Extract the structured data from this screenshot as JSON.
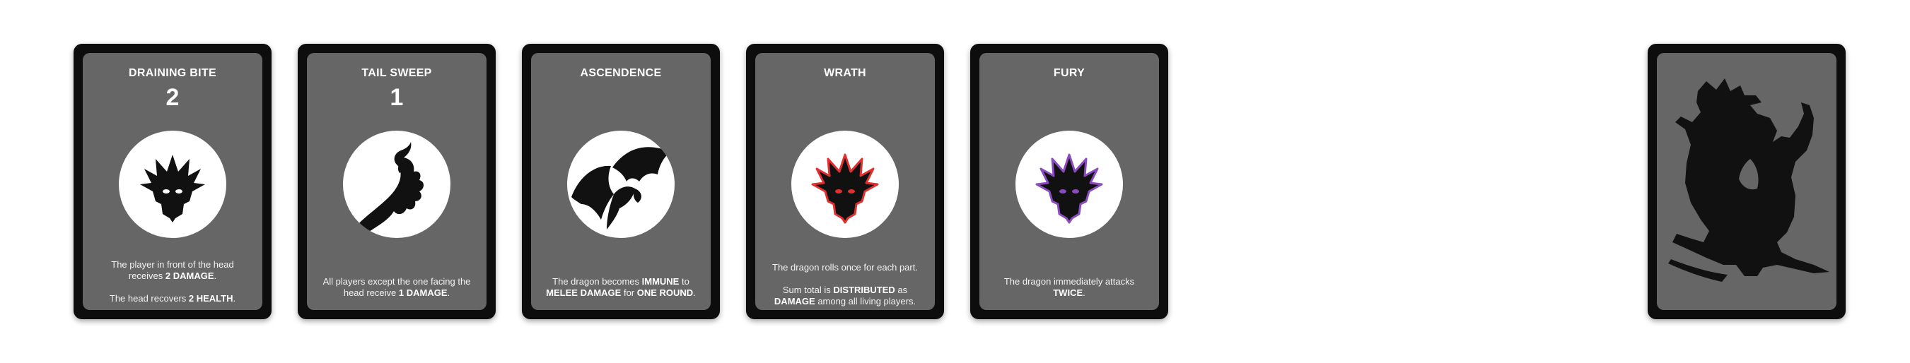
{
  "cards": [
    {
      "title": "DRAINING BITE",
      "number": "2",
      "icon": "dragon-head-icon",
      "text": [
        [
          "The player in front of the head receives ",
          "2 DAMAGE",
          "."
        ],
        [
          "The head recovers ",
          "2 HEALTH",
          "."
        ]
      ]
    },
    {
      "title": "TAIL SWEEP",
      "number": "1",
      "icon": "dragon-tail-icon",
      "text": [
        [
          "All players except the one facing the head receive ",
          "1 DAMAGE",
          "."
        ]
      ]
    },
    {
      "title": "ASCENDENCE",
      "icon": "dragon-wings-icon",
      "text": [
        [
          "The dragon becomes ",
          "IMMUNE",
          " to ",
          "MELEE DAMAGE",
          " for ",
          "ONE ROUND",
          "."
        ]
      ]
    },
    {
      "title": "WRATH",
      "icon": "dragon-head-red-icon",
      "accent": "#e03030",
      "text": [
        [
          "The dragon rolls once for each part."
        ],
        [
          "Sum total is ",
          "DISTRIBUTED",
          " as ",
          "DAMAGE",
          " among all living players."
        ]
      ]
    },
    {
      "title": "FURY",
      "icon": "dragon-head-purple-icon",
      "accent": "#8a4bbf",
      "text": [
        [
          "The dragon immediately attacks ",
          "TWICE",
          "."
        ]
      ]
    }
  ],
  "card_back": {
    "icon": "dragon-silhouette-icon"
  },
  "colors": {
    "card_border": "#0d0d0d",
    "card_face": "#666666",
    "emblem": "#ffffff",
    "ink": "#111111"
  }
}
